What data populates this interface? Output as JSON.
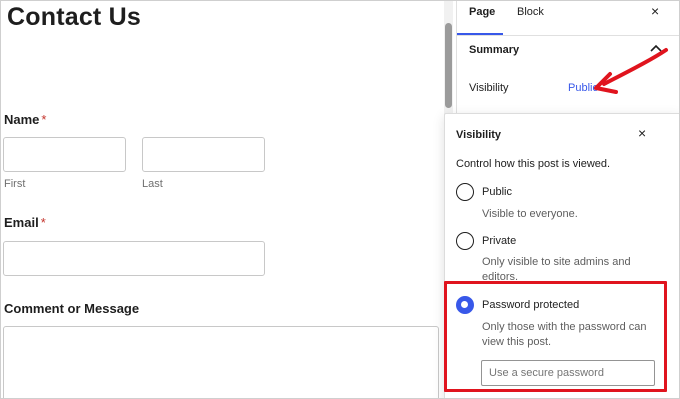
{
  "form": {
    "title": "Contact Us",
    "name_label": "Name",
    "required_mark": "*",
    "first_sublabel": "First",
    "last_sublabel": "Last",
    "email_label": "Email",
    "comment_label": "Comment or Message"
  },
  "sidebar": {
    "tabs": [
      {
        "label": "Page",
        "active": true
      },
      {
        "label": "Block",
        "active": false
      }
    ],
    "close_icon": "×",
    "summary_heading": "Summary",
    "visibility_label": "Visibility",
    "visibility_value": "Public"
  },
  "popover": {
    "title": "Visibility",
    "close_icon": "×",
    "description": "Control how this post is viewed.",
    "options": [
      {
        "label": "Public",
        "help": "Visible to everyone.",
        "selected": false
      },
      {
        "label": "Private",
        "help": "Only visible to site admins and editors.",
        "selected": false
      },
      {
        "label": "Password protected",
        "help": "Only those with the password can view this post.",
        "selected": true
      }
    ],
    "password_placeholder": "Use a secure password"
  },
  "colors": {
    "accent": "#3858e9",
    "annotation": "#e0141e",
    "required": "#c4332b"
  }
}
